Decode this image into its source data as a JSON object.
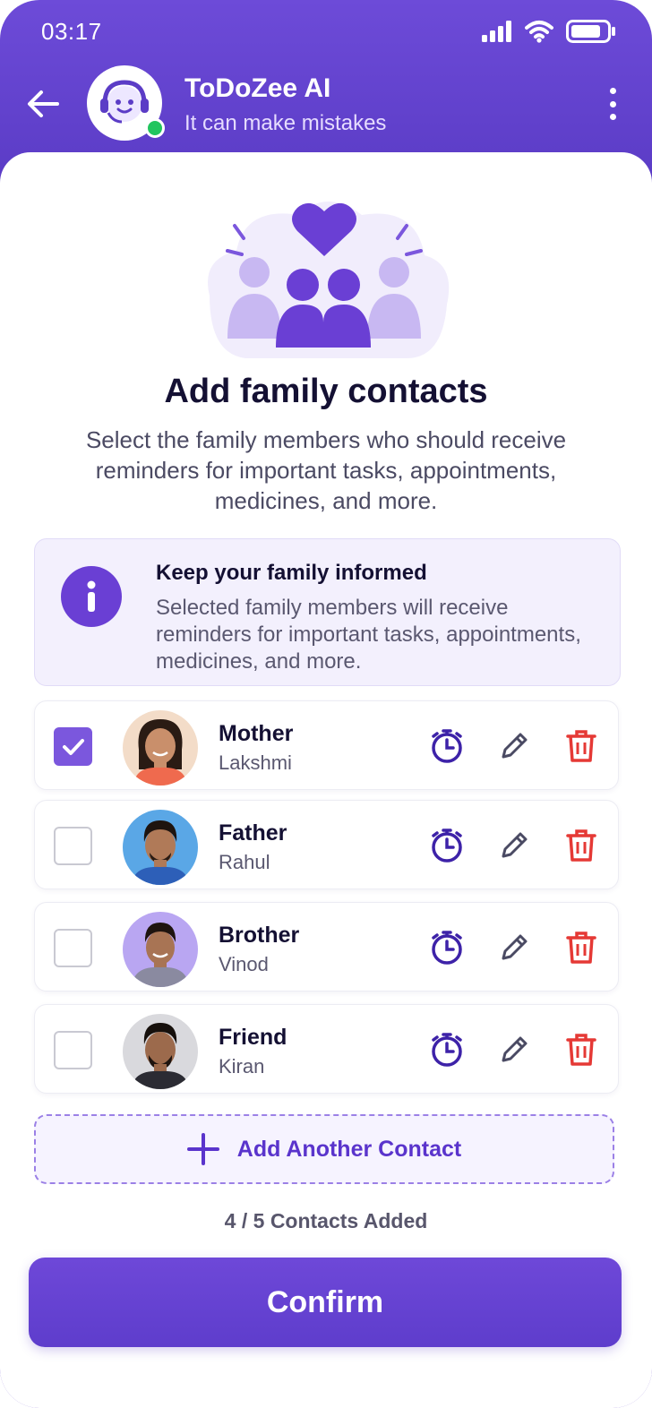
{
  "status_bar": {
    "time": "03:17"
  },
  "header": {
    "title": "ToDoZee AI",
    "subtitle": "It can make mistakes"
  },
  "main": {
    "title": "Add family contacts",
    "subtitle": "Select the family members who should receive reminders for important tasks, appointments, medicines, and more."
  },
  "info_card": {
    "title": "Keep your family informed",
    "text": "Selected family members will receive reminders for important tasks, appointments, medicines, and more."
  },
  "contacts": [
    {
      "relation": "Mother",
      "name": "Lakshmi",
      "checked": true
    },
    {
      "relation": "Father",
      "name": "Rahul",
      "checked": false
    },
    {
      "relation": "Brother",
      "name": "Vinod",
      "checked": false
    },
    {
      "relation": "Friend",
      "name": "Kiran",
      "checked": false
    }
  ],
  "add_contact_label": "Add Another Contact",
  "contacts_count": "4 / 5 Contacts Added",
  "confirm_label": "Confirm",
  "colors": {
    "primary": "#5b3cc6",
    "accent": "#6a3fd4",
    "delete": "#e53935",
    "online": "#22c55e"
  }
}
